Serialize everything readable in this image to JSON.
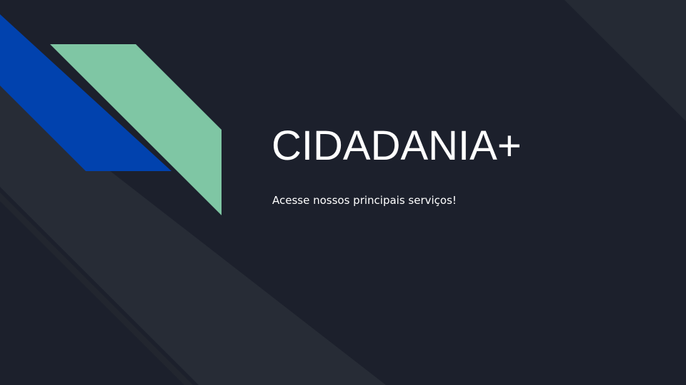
{
  "slide": {
    "title": "CIDADANIA+",
    "subtitle": "Acesse nossos principais serviços!"
  },
  "theme": {
    "background": "#1c202c",
    "band_color": "#272c36",
    "blue_accent": "#0142ae",
    "green_accent": "#7fc6a4",
    "text_color": "#ffffff"
  }
}
